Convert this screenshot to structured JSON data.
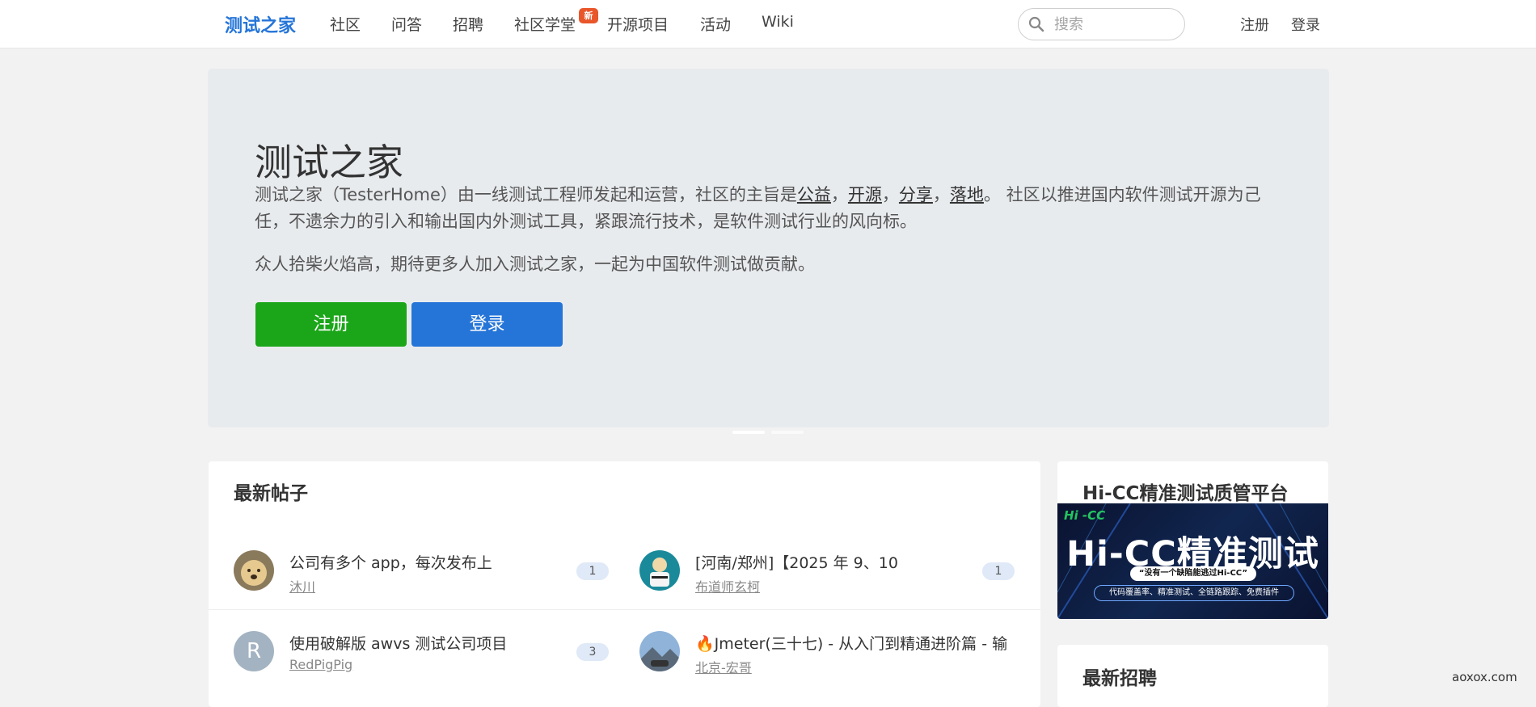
{
  "nav": {
    "brand": "测试之家",
    "links": [
      "社区",
      "问答",
      "招聘",
      "社区学堂",
      "开源项目",
      "活动",
      "Wiki"
    ],
    "new_badge": "新",
    "search_placeholder": "搜索",
    "register": "注册",
    "login": "登录"
  },
  "hero": {
    "title": "测试之家",
    "p1_pre": "测试之家（TesterHome）由一线测试工程师发起和运营，社区的主旨是",
    "p1_links": [
      "公益",
      "开源",
      "分享",
      "落地"
    ],
    "p1_sep": "，",
    "p1_post": "。 社区以推进国内软件测试开源为己任，不遗余力的引入和输出国内外测试工具，紧跟流行技术，是软件测试行业的风向标。",
    "p2": "众人拾柴火焰高，期待更多人加入测试之家，一起为中国软件测试做贡献。",
    "register_button": "注册",
    "login_button": "登录"
  },
  "topics": {
    "title": "最新帖子",
    "items": [
      {
        "title": "公司有多个 app，每次发布上",
        "author": "沐川",
        "count": "1"
      },
      {
        "title": "[河南/郑州]【2025 年 9、10",
        "author": "布道师玄柯",
        "count": "1"
      },
      {
        "title": "使用破解版 awvs 测试公司项目",
        "author": "RedPigPig",
        "count": "3",
        "avatar_letter": "R"
      },
      {
        "title": "🔥Jmeter(三十七) - 从入门到精通进阶篇 - 输",
        "author": "北京-宏哥",
        "count": ""
      }
    ]
  },
  "sidebar": {
    "ad_title": "Hi-CC精准测试质管平台",
    "ad_corner": "Hi -CC",
    "ad_main": "Hi-CC精准测试",
    "ad_sub": "“没有一个缺陷能逃过Hi-CC”",
    "ad_pill": "代码覆盖率、精准测试、全链路跟踪、免费插件",
    "jobs_title": "最新招聘"
  },
  "watermark": "aoxox.com"
}
